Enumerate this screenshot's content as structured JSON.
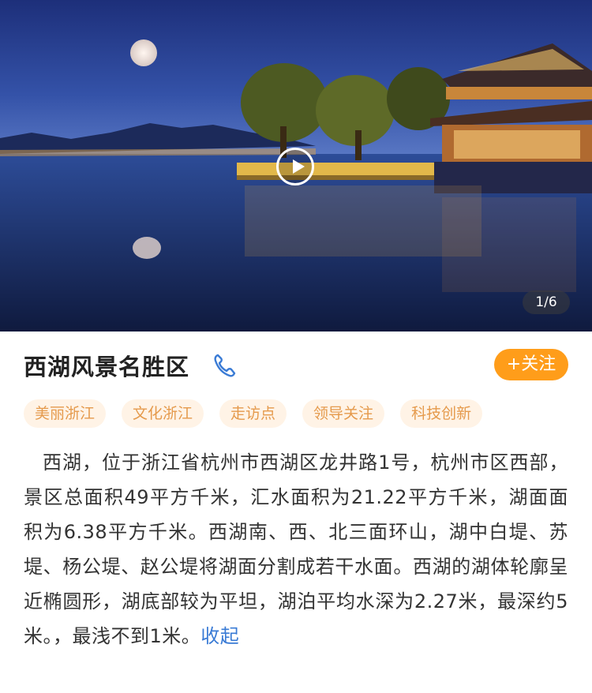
{
  "hero": {
    "image_description_icon": "west-lake-night-photo",
    "counter": "1/6"
  },
  "title": "西湖风景名胜区",
  "follow_label": "+关注",
  "tags": [
    "美丽浙江",
    "文化浙江",
    "走访点",
    "领导关注",
    "科技创新"
  ],
  "description": "西湖，位于浙江省杭州市西湖区龙井路1号，杭州市区西部，景区总面积49平方千米，汇水面积为21.22平方千米，湖面面积为6.38平方千米。西湖南、西、北三面环山，湖中白堤、苏堤、杨公堤、赵公堤将湖面分割成若干水面。西湖的湖体轮廓呈近椭圆形，湖底部较为平坦，湖泊平均水深为2.27米，最深约5米。，最浅不到1米。",
  "collapse_label": "收起",
  "colors": {
    "accent": "#ff9d1a",
    "tag_bg": "#fff3e6",
    "tag_text": "#e59a4c",
    "link": "#3a7bd5"
  }
}
